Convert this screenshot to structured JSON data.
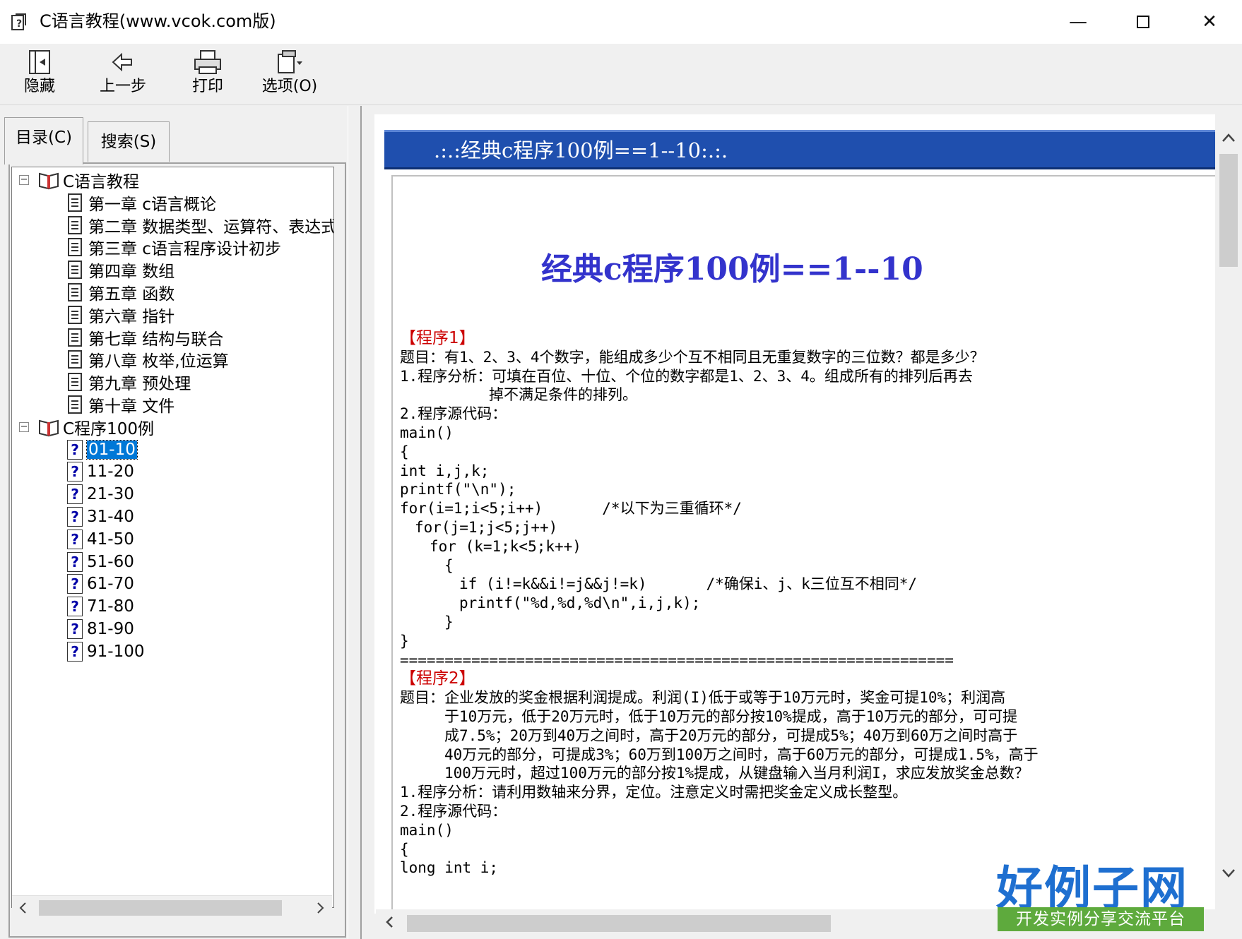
{
  "window": {
    "title": "C语言教程(www.vcok.com版)",
    "minimize_glyph": "—",
    "close_glyph": "✕"
  },
  "toolbar": {
    "items": [
      {
        "label": "隐藏",
        "icon": "hide-icon"
      },
      {
        "label": "上一步",
        "icon": "back-arrow-icon"
      },
      {
        "label": "打印",
        "icon": "printer-icon"
      },
      {
        "label": "选项(O)",
        "icon": "options-icon"
      }
    ]
  },
  "tabs": {
    "contents": "目录(C)",
    "search": "搜索(S)"
  },
  "tree": {
    "root1": {
      "label": "C语言教程",
      "children": [
        "第一章 c语言概论",
        "第二章 数据类型、运算符、表达式",
        "第三章 c语言程序设计初步",
        "第四章 数组",
        "第五章 函数",
        "第六章 指针",
        "第七章 结构与联合",
        "第八章 枚举,位运算",
        "第九章 预处理",
        "第十章 文件"
      ]
    },
    "root2": {
      "label": "C程序100例",
      "children": [
        "01-10",
        "11-20",
        "21-30",
        "31-40",
        "41-50",
        "51-60",
        "61-70",
        "71-80",
        "81-90",
        "91-100"
      ],
      "selected": "01-10"
    },
    "expander_glyph": "−"
  },
  "content": {
    "banner": ".:.:经典c程序100例==1--10:.:.",
    "title": "经典c程序100例==1--10",
    "program1": {
      "heading": "【程序1】",
      "lines": [
        "题目：有1、2、3、4个数字，能组成多少个互不相同且无重复数字的三位数？都是多少？",
        "1.程序分析：可填在百位、十位、个位的数字都是1、2、3、4。组成所有的排列后再去",
        "　　　　　　掉不满足条件的排列。",
        "2.程序源代码：",
        "main()",
        "{",
        "int i,j,k;",
        "printf(\"\\n\");",
        "for(i=1;i<5;i++)　　　　/*以下为三重循环*/",
        "　for(j=1;j<5;j++)",
        "　　for (k=1;k<5;k++)",
        "　　　{",
        "　　　　if (i!=k&&i!=j&&j!=k)　　　　/*确保i、j、k三位互不相同*/",
        "　　　　printf(\"%d,%d,%d\\n\",i,j,k);",
        "　　　}",
        "}"
      ]
    },
    "separator": "==============================================================",
    "program2": {
      "heading": "【程序2】",
      "lines": [
        "题目：企业发放的奖金根据利润提成。利润(I)低于或等于10万元时，奖金可提10%；利润高",
        "　　　于10万元，低于20万元时，低于10万元的部分按10%提成，高于10万元的部分，可可提",
        "　　　成7.5%；20万到40万之间时，高于20万元的部分，可提成5%；40万到60万之间时高于",
        "　　　40万元的部分，可提成3%；60万到100万之间时，高于60万元的部分，可提成1.5%，高于",
        "　　　100万元时，超过100万元的部分按1%提成，从键盘输入当月利润I，求应发放奖金总数？",
        "1.程序分析：请利用数轴来分界，定位。注意定义时需把奖金定义成长整型。",
        "2.程序源代码：",
        "main()",
        "{",
        "long int i;"
      ]
    }
  },
  "logo": {
    "main": "好例子网",
    "sub": "开发实例分享交流平台"
  },
  "colors": {
    "banner": "#1f4fae",
    "title": "#3333cc",
    "heading": "#cc0000",
    "selection": "#0078d7"
  }
}
